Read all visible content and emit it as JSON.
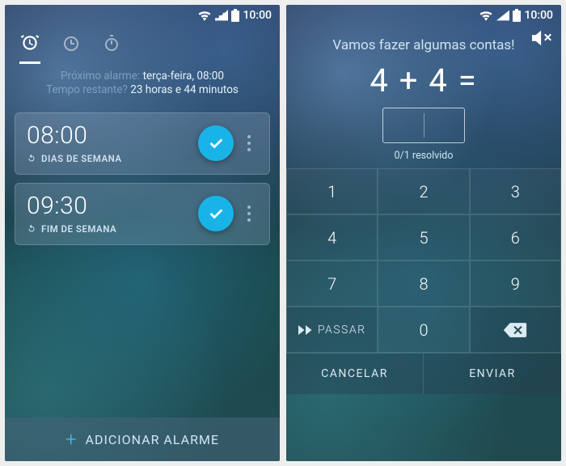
{
  "status": {
    "time": "10:00"
  },
  "left": {
    "next_alarm_label": "Próximo alarme:",
    "next_alarm_value": "terça-feira, 08:00",
    "time_left_label": "Tempo restante?",
    "time_left_value": "23 horas e 44 minutos",
    "alarms": [
      {
        "time": "08:00",
        "label": "DIAS DE SEMANA"
      },
      {
        "time": "09:30",
        "label": "FIM DE SEMANA"
      }
    ],
    "add_label": "ADICIONAR ALARME"
  },
  "right": {
    "title": "Vamos fazer algumas contas!",
    "equation": "4 + 4 =",
    "solved": "0/1 resolvido",
    "keys": [
      "1",
      "2",
      "3",
      "4",
      "5",
      "6",
      "7",
      "8",
      "9"
    ],
    "skip": "PASSAR",
    "zero": "0",
    "cancel": "CANCELAR",
    "send": "ENVIAR"
  }
}
